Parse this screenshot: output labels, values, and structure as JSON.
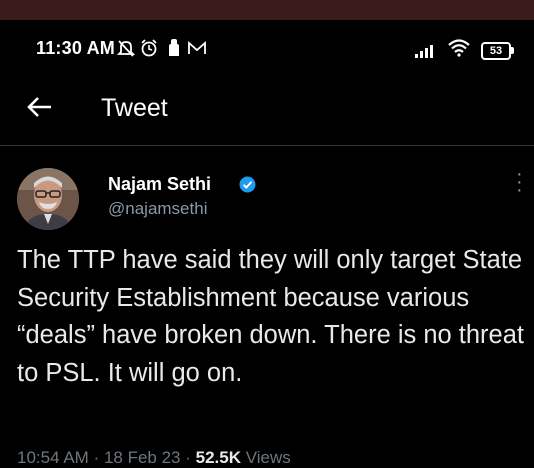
{
  "status": {
    "time": "11:30 AM",
    "notification_icons": [
      "silent-icon",
      "alarm-icon",
      "hand-icon",
      "mail-icon"
    ],
    "battery": "53"
  },
  "header": {
    "back_icon": "arrow-left-icon",
    "title": "Tweet"
  },
  "tweet": {
    "author_name": "Najam Sethi",
    "handle": "@najamsethi",
    "verified": true,
    "text": "The TTP have said they will only target State Security Establishment because various “deals” have broken down. There is no threat to PSL. It will go on.",
    "time": "10:54 AM",
    "date": "18 Feb 23",
    "views_count": "52.5K",
    "views_label": "Views"
  },
  "colors": {
    "background": "#000000",
    "text": "#e7e9ea",
    "secondary": "#8b98a5",
    "verified": "#1d9bf0",
    "top_band": "#3a1a1a"
  }
}
